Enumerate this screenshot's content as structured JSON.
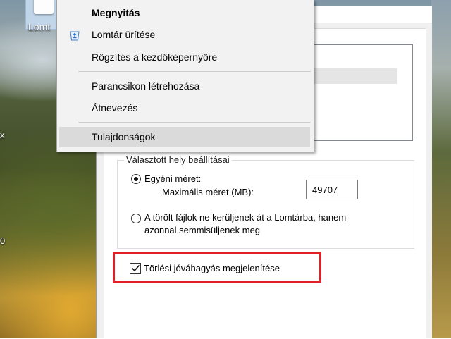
{
  "desktop": {
    "icon_label": "Lomt",
    "edge_glyphs": [
      "x",
      "0"
    ]
  },
  "context_menu": {
    "items": [
      {
        "label": "Megnyitás",
        "bold": true
      },
      {
        "label": "Lomtár ürítése",
        "icon": "recycle-bin-icon"
      },
      {
        "label": "Rögzítés a kezdőképernyőre"
      },
      {
        "label": "Parancsikon létrehozása"
      },
      {
        "label": "Átnevezés"
      },
      {
        "label": "Tulajdonságok",
        "highlighted": true
      }
    ]
  },
  "properties": {
    "group_label": "Választott hely beállításai",
    "custom_size_label": "Egyéni méret:",
    "max_size_label": "Maximális méret (MB):",
    "max_size_value": "49707",
    "no_recycle_label_line1": "A törölt fájlok ne kerüljenek át a Lomtárba, hanem",
    "no_recycle_label_line2": "azonnal semmisüljenek meg",
    "confirm_label": "Törlési jóváhagyás megjelenítése",
    "custom_size_selected": true,
    "confirm_checked": true,
    "highlight_color": "#e21f26"
  }
}
